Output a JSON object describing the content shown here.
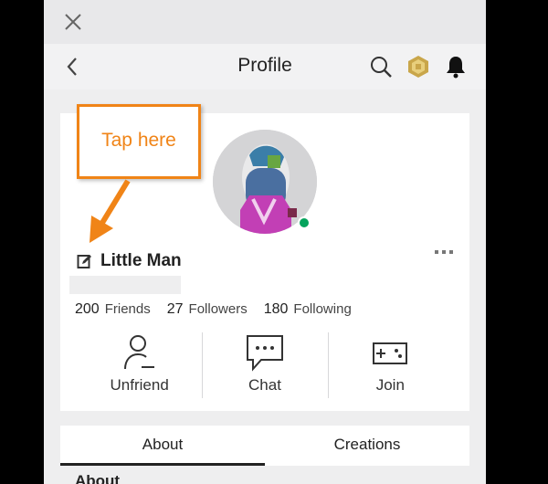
{
  "window": {
    "close_icon": "close-icon"
  },
  "navbar": {
    "title": "Profile",
    "back_icon": "chevron-left-icon",
    "search_icon": "search-icon",
    "robux_icon": "robux-icon",
    "notifications_icon": "bell-icon"
  },
  "profile": {
    "display_name": "Little Man",
    "online_status_color": "#05a35c",
    "stats": [
      {
        "value": "200",
        "label": "Friends"
      },
      {
        "value": "27",
        "label": "Followers"
      },
      {
        "value": "180",
        "label": "Following"
      }
    ],
    "actions": [
      {
        "label": "Unfriend",
        "icon": "person-minus-icon"
      },
      {
        "label": "Chat",
        "icon": "chat-icon"
      },
      {
        "label": "Join",
        "icon": "gamepad-icon"
      }
    ]
  },
  "tabs": [
    {
      "label": "About",
      "active": true
    },
    {
      "label": "Creations",
      "active": false
    }
  ],
  "section": {
    "about_heading": "About"
  },
  "annotation": {
    "text": "Tap here",
    "color": "#f08417"
  }
}
